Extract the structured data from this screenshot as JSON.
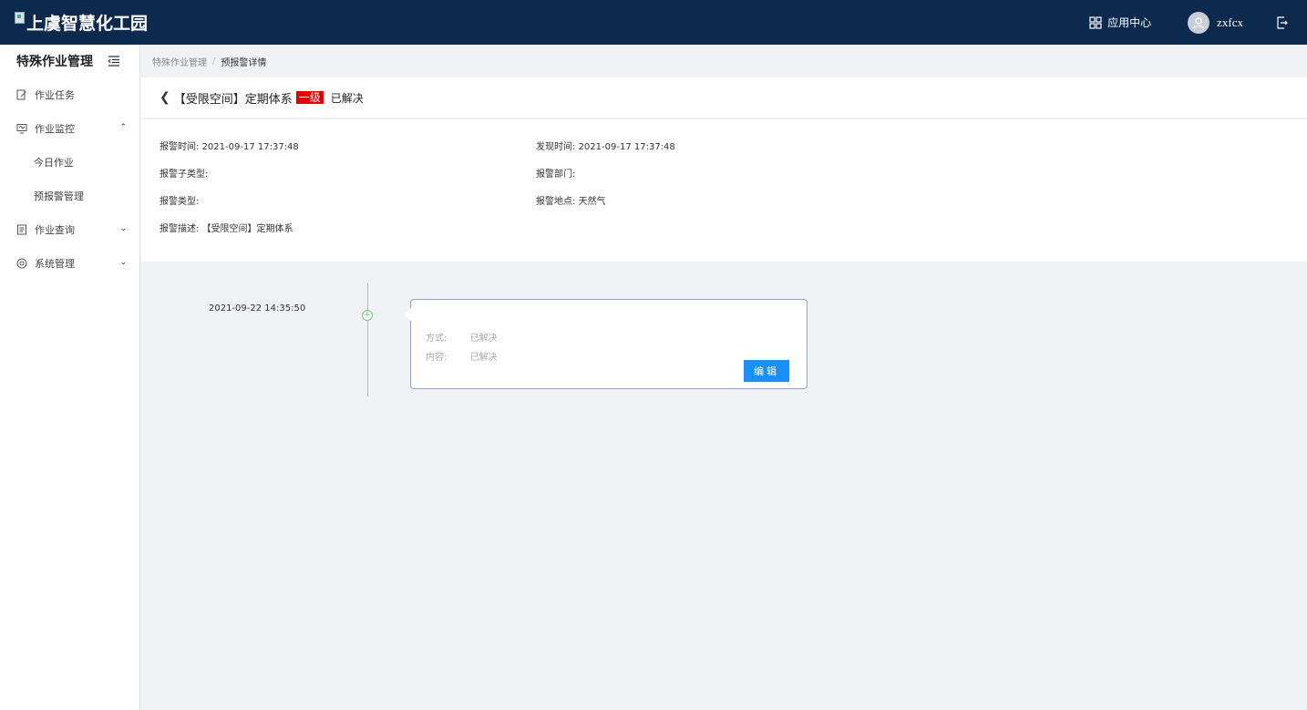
{
  "header": {
    "logo_text": "上虞智慧化工园",
    "app_center_label": "应用中心",
    "username": "zxfcx"
  },
  "sidebar": {
    "title": "特殊作业管理",
    "items": [
      {
        "label": "作业任务",
        "icon": "edit-icon"
      },
      {
        "label": "作业监控",
        "icon": "monitor-icon",
        "expanded": true,
        "children": [
          {
            "label": "今日作业"
          },
          {
            "label": "预报警管理"
          }
        ]
      },
      {
        "label": "作业查询",
        "icon": "document-icon",
        "expanded": false
      },
      {
        "label": "系统管理",
        "icon": "settings-icon",
        "expanded": false
      }
    ]
  },
  "breadcrumb": {
    "parent": "特殊作业管理",
    "separator": "/",
    "current": "预报警详情"
  },
  "detail_header": {
    "title": "【受限空间】定期体系",
    "level": "一级",
    "status": "已解决",
    "level_color": "#e60000"
  },
  "info": {
    "alarm_time_label": "报警时间:",
    "alarm_time_value": "2021-09-17 17:37:48",
    "found_time_label": "发现时间:",
    "found_time_value": "2021-09-17 17:37:48",
    "sub_type_label": "报警子类型:",
    "sub_type_value": "",
    "dept_label": "报警部门:",
    "dept_value": "",
    "type_label": "报警类型:",
    "type_value": "",
    "location_label": "报警地点:",
    "location_value": "天然气",
    "desc_label": "报警描述:",
    "desc_value": "【受限空间】定期体系"
  },
  "timeline": {
    "time": "2021-09-22 14:35:50",
    "method_label": "方式:",
    "method_value": "已解决",
    "content_label": "内容:",
    "content_value": "已解决",
    "edit_label": "编辑",
    "edit_color": "#1890ff"
  }
}
